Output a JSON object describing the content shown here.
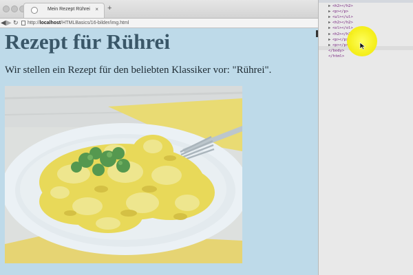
{
  "browser": {
    "tab_title": "Mein Rezept Rührei",
    "tab_close": "×",
    "new_tab": "+",
    "back": "◀",
    "forward": "▶",
    "reload": "↻",
    "url_host": "localhost",
    "url_prefix": "http://",
    "url_path": "/HTMLBasics/16-bilder/img.html"
  },
  "page": {
    "title": "Rezept für Rührei",
    "intro": "Wir stellen ein Rezept für den beliebten Klassiker vor: \"Rührei\"."
  },
  "devtools": {
    "lines": [
      {
        "arrow": "▶",
        "text": "<h2></h2>"
      },
      {
        "arrow": "▶",
        "text": "<p></p>"
      },
      {
        "arrow": "▶",
        "text": "<ul></ul>"
      },
      {
        "arrow": "▶",
        "text": "<h2></h2>"
      },
      {
        "arrow": "▶",
        "text": "<ol></ol>"
      },
      {
        "arrow": "▶",
        "text": "<h2></h2>"
      },
      {
        "arrow": "▶",
        "text": "<p></p>"
      },
      {
        "arrow": "▶",
        "text": "<p></p>"
      },
      {
        "arrow": "",
        "text": "</body>"
      },
      {
        "arrow": "",
        "text": "</html>"
      }
    ]
  },
  "colors": {
    "page_background": "#bedae9",
    "heading": "#3a5768",
    "highlight": "#f6f014",
    "dom_tag": "#75227e"
  }
}
